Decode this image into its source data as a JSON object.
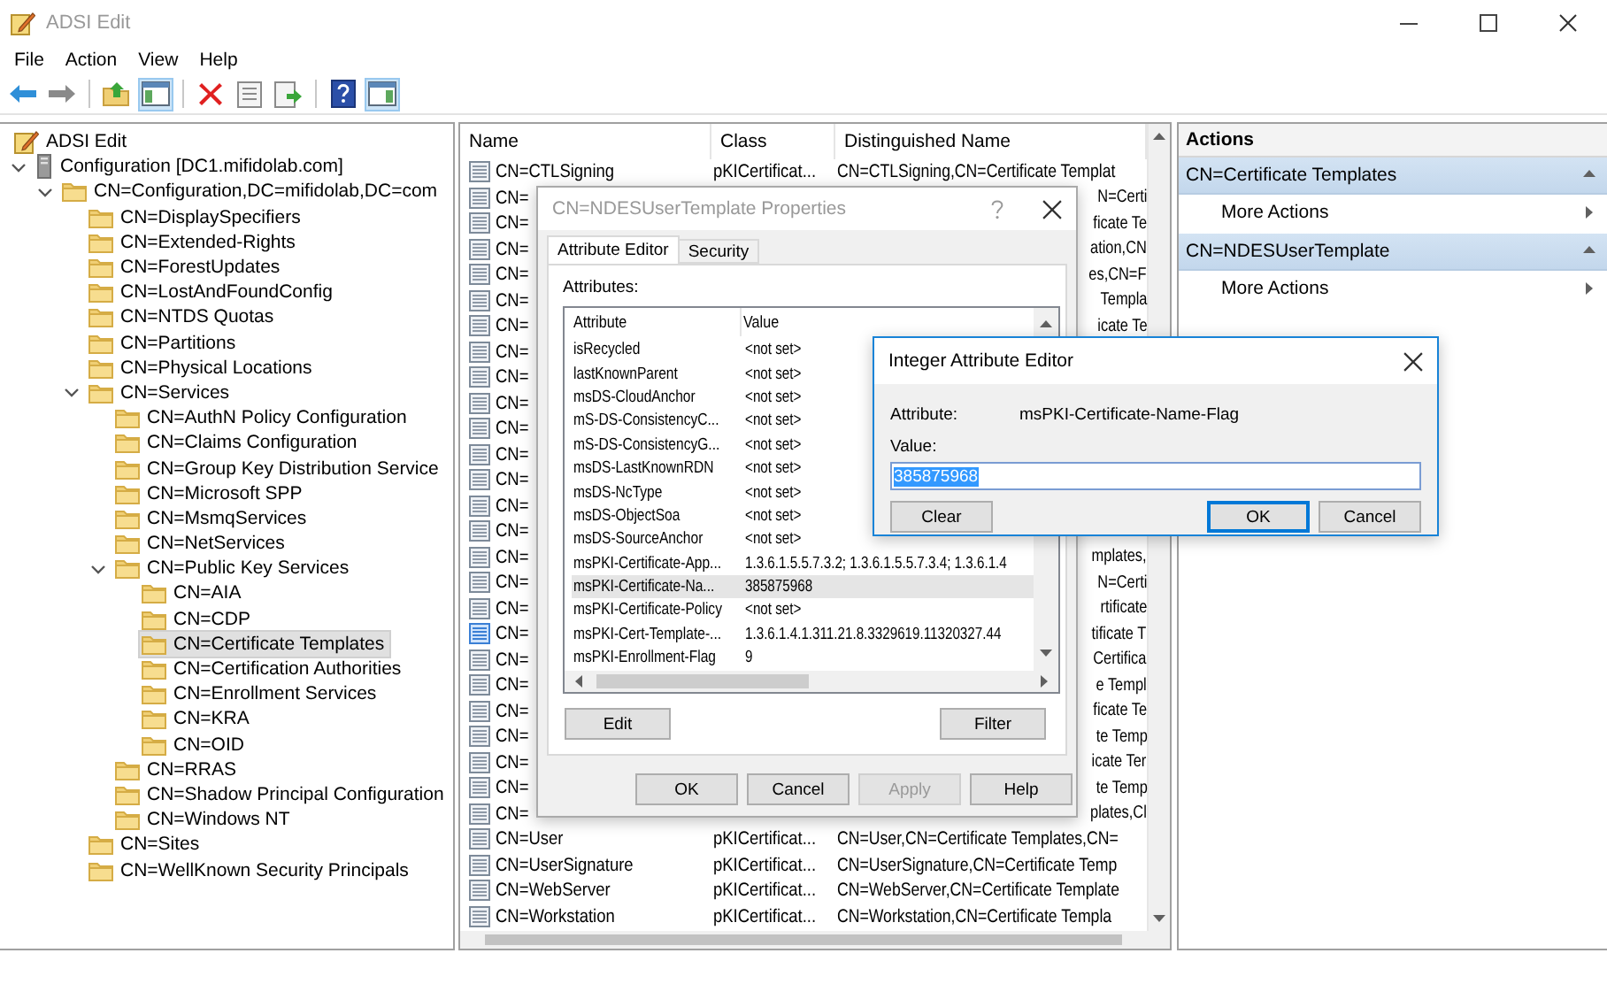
{
  "window": {
    "title": "ADSI Edit",
    "active": false
  },
  "menu": [
    "File",
    "Action",
    "View",
    "Help"
  ],
  "toolbar": [
    [
      {
        "kind": "back",
        "pressed": false
      },
      {
        "kind": "forward",
        "pressed": false
      }
    ],
    [
      {
        "kind": "up",
        "pressed": false
      },
      {
        "kind": "tree-pane",
        "pressed": true
      }
    ],
    [
      {
        "kind": "delete",
        "pressed": false
      },
      {
        "kind": "properties",
        "pressed": false
      },
      {
        "kind": "export",
        "pressed": false
      }
    ],
    [
      {
        "kind": "help",
        "pressed": false
      },
      {
        "kind": "action-pane",
        "pressed": true
      }
    ]
  ],
  "tree": {
    "label": "ADSI Edit",
    "kind": "root",
    "selected": false,
    "children": [
      {
        "label": "Configuration [DC1.mifidolab.com]",
        "kind": "server",
        "selected": false,
        "expanded": true,
        "children": [
          {
            "label": "CN=Configuration,DC=mifidolab,DC=com",
            "kind": "folder",
            "selected": false,
            "expanded": true,
            "children": [
              {
                "label": "CN=DisplaySpecifiers",
                "kind": "folder",
                "selected": false
              },
              {
                "label": "CN=Extended-Rights",
                "kind": "folder",
                "selected": false
              },
              {
                "label": "CN=ForestUpdates",
                "kind": "folder",
                "selected": false
              },
              {
                "label": "CN=LostAndFoundConfig",
                "kind": "folder",
                "selected": false
              },
              {
                "label": "CN=NTDS Quotas",
                "kind": "folder",
                "selected": false
              },
              {
                "label": "CN=Partitions",
                "kind": "folder",
                "selected": false
              },
              {
                "label": "CN=Physical Locations",
                "kind": "folder",
                "selected": false
              },
              {
                "label": "CN=Services",
                "kind": "folder",
                "selected": false,
                "expanded": true,
                "children": [
                  {
                    "label": "CN=AuthN Policy Configuration",
                    "kind": "folder",
                    "selected": false
                  },
                  {
                    "label": "CN=Claims Configuration",
                    "kind": "folder",
                    "selected": false
                  },
                  {
                    "label": "CN=Group Key Distribution Service",
                    "kind": "folder",
                    "selected": false
                  },
                  {
                    "label": "CN=Microsoft SPP",
                    "kind": "folder",
                    "selected": false
                  },
                  {
                    "label": "CN=MsmqServices",
                    "kind": "folder",
                    "selected": false
                  },
                  {
                    "label": "CN=NetServices",
                    "kind": "folder",
                    "selected": false
                  },
                  {
                    "label": "CN=Public Key Services",
                    "kind": "folder",
                    "selected": false,
                    "expanded": true,
                    "children": [
                      {
                        "label": "CN=AIA",
                        "kind": "folder",
                        "selected": false
                      },
                      {
                        "label": "CN=CDP",
                        "kind": "folder",
                        "selected": false
                      },
                      {
                        "label": "CN=Certificate Templates",
                        "kind": "folder",
                        "selected": true
                      },
                      {
                        "label": "CN=Certification Authorities",
                        "kind": "folder",
                        "selected": false
                      },
                      {
                        "label": "CN=Enrollment Services",
                        "kind": "folder",
                        "selected": false
                      },
                      {
                        "label": "CN=KRA",
                        "kind": "folder",
                        "selected": false
                      },
                      {
                        "label": "CN=OID",
                        "kind": "folder",
                        "selected": false
                      }
                    ]
                  },
                  {
                    "label": "CN=RRAS",
                    "kind": "folder",
                    "selected": false
                  },
                  {
                    "label": "CN=Shadow Principal Configuration",
                    "kind": "folder",
                    "selected": false
                  },
                  {
                    "label": "CN=Windows NT",
                    "kind": "folder",
                    "selected": false
                  }
                ]
              },
              {
                "label": "CN=Sites",
                "kind": "folder",
                "selected": false
              },
              {
                "label": "CN=WellKnown Security Principals",
                "kind": "folder",
                "selected": false
              }
            ]
          }
        ]
      }
    ]
  },
  "list": {
    "columns": [
      "Name",
      "Class",
      "Distinguished Name"
    ],
    "rows": [
      {
        "kind": "full",
        "name": "CN=CTLSigning",
        "class": "pKICertificat...",
        "dn": "CN=CTLSigning,CN=Certificate Templat",
        "selected": false
      },
      {
        "kind": "covered",
        "name": "CN=",
        "dn": "N=Certi",
        "selected": false
      },
      {
        "kind": "covered",
        "name": "CN=",
        "dn": "ficate Te",
        "selected": false
      },
      {
        "kind": "covered",
        "name": "CN=",
        "dn": "ation,CN",
        "selected": false
      },
      {
        "kind": "covered",
        "name": "CN=",
        "dn": "es,CN=F",
        "selected": false
      },
      {
        "kind": "covered",
        "name": "CN=",
        "dn": "Templa",
        "selected": false
      },
      {
        "kind": "covered",
        "name": "CN=",
        "dn": "icate Te",
        "selected": false
      },
      {
        "kind": "covered",
        "name": "CN=",
        "selected": false
      },
      {
        "kind": "covered",
        "name": "CN=",
        "selected": false
      },
      {
        "kind": "covered",
        "name": "CN=",
        "selected": false
      },
      {
        "kind": "covered",
        "name": "CN=",
        "selected": false
      },
      {
        "kind": "covered",
        "name": "CN=",
        "selected": false
      },
      {
        "kind": "covered",
        "name": "CN=",
        "selected": false
      },
      {
        "kind": "covered",
        "name": "CN=",
        "selected": false
      },
      {
        "kind": "covered",
        "name": "CN=",
        "selected": false
      },
      {
        "kind": "covered",
        "name": "CN=",
        "dn": "mplates,",
        "selected": false
      },
      {
        "kind": "covered",
        "name": "CN=",
        "dn": "N=Certi",
        "selected": false
      },
      {
        "kind": "covered",
        "name": "CN=",
        "dn": "rtificate",
        "selected": false
      },
      {
        "kind": "covered",
        "name": "CN=",
        "dn": "tificate T",
        "selected": true
      },
      {
        "kind": "covered",
        "name": "CN=",
        "dn": "Certifica",
        "selected": false
      },
      {
        "kind": "covered",
        "name": "CN=",
        "dn": "e Templ",
        "selected": false
      },
      {
        "kind": "covered",
        "name": "CN=",
        "dn": "ficate Te",
        "selected": false
      },
      {
        "kind": "covered",
        "name": "CN=",
        "dn": "te Temp",
        "selected": false
      },
      {
        "kind": "covered",
        "name": "CN=",
        "dn": "icate Ter",
        "selected": false
      },
      {
        "kind": "covered",
        "name": "CN=",
        "dn": "te Temp",
        "selected": false
      },
      {
        "kind": "covered",
        "name": "CN=",
        "dn": "plates,Cl",
        "selected": false
      },
      {
        "kind": "full",
        "name": "CN=User",
        "class": "pKICertificat...",
        "dn": "CN=User,CN=Certificate Templates,CN=",
        "selected": false
      },
      {
        "kind": "full",
        "name": "CN=UserSignature",
        "class": "pKICertificat...",
        "dn": "CN=UserSignature,CN=Certificate Temp",
        "selected": false
      },
      {
        "kind": "full",
        "name": "CN=WebServer",
        "class": "pKICertificat...",
        "dn": "CN=WebServer,CN=Certificate Template",
        "selected": false
      },
      {
        "kind": "full",
        "name": "CN=Workstation",
        "class": "pKICertificat...",
        "dn": "CN=Workstation,CN=Certificate Templa",
        "selected": false
      }
    ]
  },
  "actions": {
    "title": "Actions",
    "groups": [
      {
        "title": "CN=Certificate Templates",
        "expanded": true,
        "items": [
          "More Actions"
        ]
      },
      {
        "title": "CN=NDESUserTemplate",
        "expanded": true,
        "items": [
          "More Actions"
        ]
      }
    ]
  },
  "properties_dialog": {
    "title": "CN=NDESUserTemplate Properties",
    "active": false,
    "tabs": [
      {
        "label": "Attribute Editor",
        "selected": true
      },
      {
        "label": "Security",
        "selected": false
      }
    ],
    "attributes_label": "Attributes:",
    "columns": [
      "Attribute",
      "Value"
    ],
    "rows": [
      {
        "attribute": "isRecycled",
        "value": "<not set>",
        "selected": false
      },
      {
        "attribute": "lastKnownParent",
        "value": "<not set>",
        "selected": false
      },
      {
        "attribute": "msDS-CloudAnchor",
        "value": "<not set>",
        "selected": false
      },
      {
        "attribute": "mS-DS-ConsistencyC...",
        "value": "<not set>",
        "selected": false
      },
      {
        "attribute": "mS-DS-ConsistencyG...",
        "value": "<not set>",
        "selected": false
      },
      {
        "attribute": "msDS-LastKnownRDN",
        "value": "<not set>",
        "selected": false
      },
      {
        "attribute": "msDS-NcType",
        "value": "<not set>",
        "selected": false
      },
      {
        "attribute": "msDS-ObjectSoa",
        "value": "<not set>",
        "selected": false
      },
      {
        "attribute": "msDS-SourceAnchor",
        "value": "<not set>",
        "selected": false
      },
      {
        "attribute": "msPKI-Certificate-App...",
        "value": "1.3.6.1.5.5.7.3.2; 1.3.6.1.5.5.7.3.4; 1.3.6.1.4",
        "selected": false
      },
      {
        "attribute": "msPKI-Certificate-Na...",
        "value": "385875968",
        "selected": true
      },
      {
        "attribute": "msPKI-Certificate-Policy",
        "value": "<not set>",
        "selected": false
      },
      {
        "attribute": "msPKI-Cert-Template-...",
        "value": "1.3.6.1.4.1.311.21.8.3329619.11320327.44",
        "selected": false
      },
      {
        "attribute": "msPKI-Enrollment-Flag",
        "value": "9",
        "selected": false
      }
    ],
    "list_buttons": [
      "Edit",
      "Filter"
    ],
    "buttons": [
      {
        "label": "OK",
        "disabled": false
      },
      {
        "label": "Cancel",
        "disabled": false
      },
      {
        "label": "Apply",
        "disabled": true
      },
      {
        "label": "Help",
        "disabled": false
      }
    ]
  },
  "integer_editor": {
    "title": "Integer Attribute Editor",
    "active": true,
    "attribute_label": "Attribute:",
    "attribute": "msPKI-Certificate-Name-Flag",
    "value_label": "Value:",
    "value": "385875968",
    "value_selected": true,
    "buttons": [
      {
        "label": "Clear",
        "default": false
      },
      {
        "label": "OK",
        "default": true
      },
      {
        "label": "Cancel",
        "default": false
      }
    ]
  }
}
